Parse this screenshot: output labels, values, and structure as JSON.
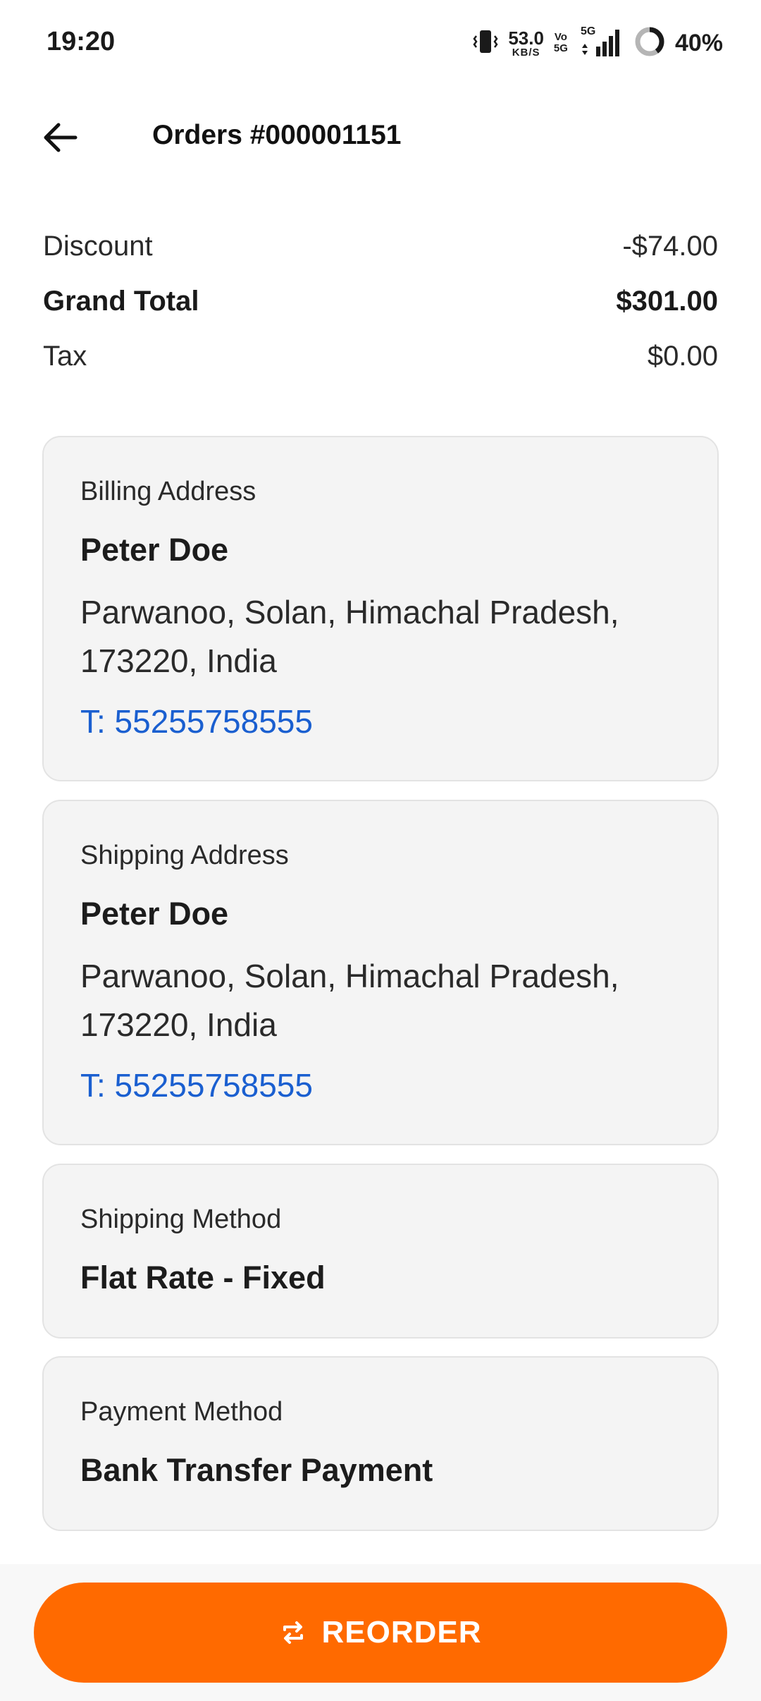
{
  "status_bar": {
    "time": "19:20",
    "net_speed": "53.0",
    "net_unit": "KB/S",
    "vo_top": "Vo",
    "vo_bottom": "5G",
    "network_type": "5G",
    "battery": "40%",
    "battery_level": 0.4
  },
  "app_bar": {
    "title": "Orders #000001151",
    "back_icon": "arrow-left-icon"
  },
  "totals": [
    {
      "label": "Discount",
      "value": "-$74.00",
      "bold": false
    },
    {
      "label": "Grand Total",
      "value": "$301.00",
      "bold": true
    },
    {
      "label": "Tax",
      "value": "$0.00",
      "bold": false
    }
  ],
  "billing": {
    "label": "Billing Address",
    "name": "Peter Doe",
    "address": "Parwanoo, Solan,  Himachal Pradesh, 173220, India",
    "phone": "T: 55255758555"
  },
  "shipping": {
    "label": "Shipping Address",
    "name": "Peter Doe",
    "address": "Parwanoo, Solan,  Himachal Pradesh, 173220, India",
    "phone": "T: 55255758555"
  },
  "shipping_method": {
    "label": "Shipping Method",
    "value": "Flat Rate - Fixed"
  },
  "payment_method": {
    "label": "Payment Method",
    "value": "Bank Transfer Payment"
  },
  "reorder": {
    "label": "REORDER",
    "icon": "repeat-icon"
  },
  "colors": {
    "accent": "#ff6a00",
    "link": "#1a5fd0",
    "card_bg": "#f4f4f4"
  }
}
